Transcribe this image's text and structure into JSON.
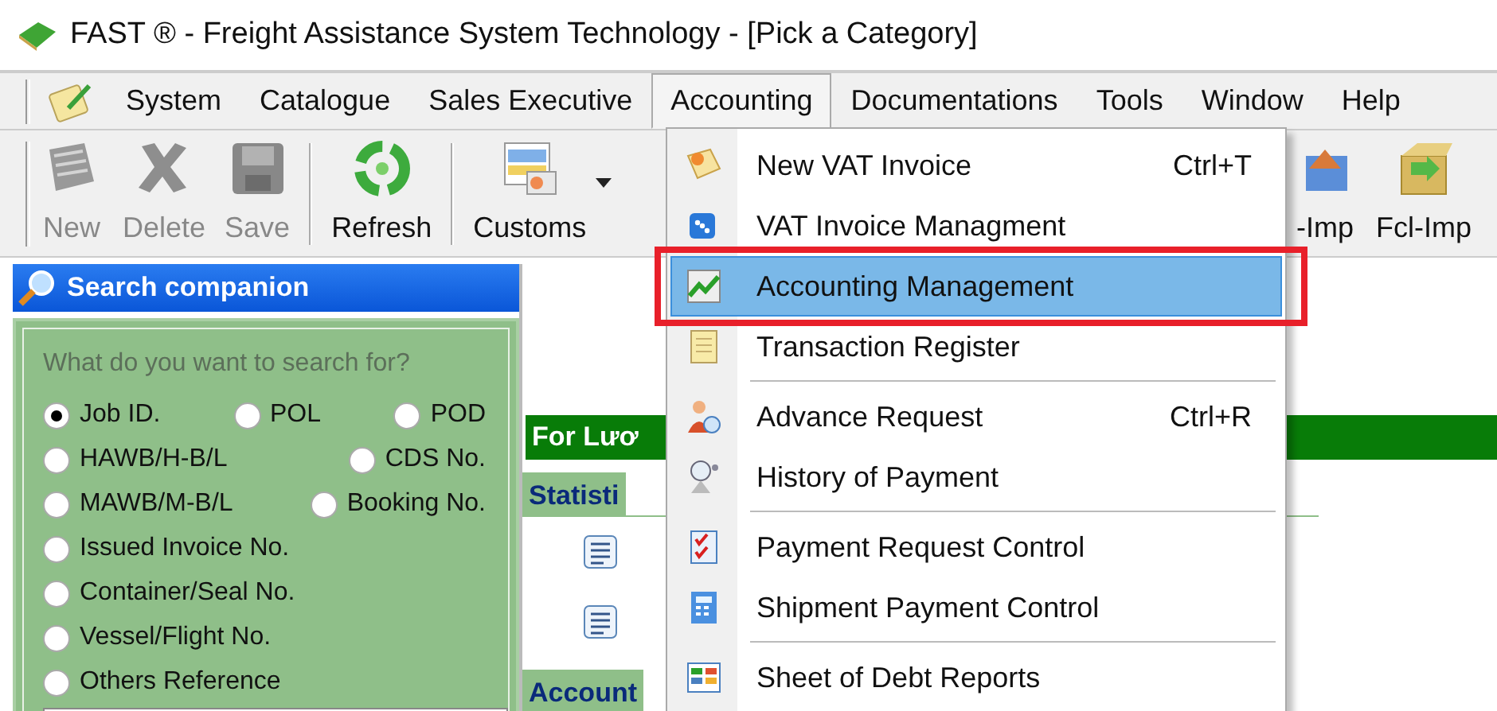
{
  "window": {
    "title": "FAST ® - Freight Assistance System Technology - [Pick a Category]"
  },
  "menubar": [
    {
      "label": "System",
      "open": false
    },
    {
      "label": "Catalogue",
      "open": false
    },
    {
      "label": "Sales Executive",
      "open": false
    },
    {
      "label": "Accounting",
      "open": true
    },
    {
      "label": "Documentations",
      "open": false
    },
    {
      "label": "Tools",
      "open": false
    },
    {
      "label": "Window",
      "open": false
    },
    {
      "label": "Help",
      "open": false
    }
  ],
  "toolbar": [
    {
      "label": "New",
      "disabled": true
    },
    {
      "label": "Delete",
      "disabled": true
    },
    {
      "label": "Save",
      "disabled": true
    },
    {
      "label": "Refresh",
      "disabled": false
    },
    {
      "label": "Customs",
      "disabled": false,
      "dropdown": true
    },
    {
      "label": "-Imp",
      "disabled": false
    },
    {
      "label": "Fcl-Imp",
      "disabled": false
    }
  ],
  "search_panel": {
    "title": "Search companion",
    "question": "What do you want to search for?",
    "options": [
      [
        {
          "label": "Job ID.",
          "selected": true
        },
        {
          "label": "POL",
          "selected": false
        },
        {
          "label": "POD",
          "selected": false
        }
      ],
      [
        {
          "label": "HAWB/H-B/L",
          "selected": false
        },
        {
          "label": "CDS No.",
          "selected": false
        }
      ],
      [
        {
          "label": "MAWB/M-B/L",
          "selected": false
        },
        {
          "label": "Booking No.",
          "selected": false
        }
      ],
      [
        {
          "label": "Issued Invoice No.",
          "selected": false
        }
      ],
      [
        {
          "label": "Container/Seal No.",
          "selected": false
        }
      ],
      [
        {
          "label": "Vessel/Flight No.",
          "selected": false
        }
      ],
      [
        {
          "label": "Others Reference",
          "selected": false
        }
      ]
    ]
  },
  "main": {
    "banner": "For Lươ",
    "sections": [
      {
        "title": "Statisti",
        "entries": [
          {
            "kind": "list"
          },
          {
            "kind": "list"
          }
        ]
      },
      {
        "title": "Account"
      }
    ]
  },
  "menu": [
    {
      "kind": "item",
      "label": "New VAT Invoice",
      "shortcut": "Ctrl+T",
      "selected": false,
      "annotated": false
    },
    {
      "kind": "item",
      "label": "VAT Invoice Managment",
      "selected": false,
      "annotated": false
    },
    {
      "kind": "item",
      "label": "Accounting Management",
      "selected": true,
      "annotated": true
    },
    {
      "kind": "item",
      "label": "Transaction Register",
      "selected": false,
      "annotated": false
    },
    {
      "kind": "separator"
    },
    {
      "kind": "item",
      "label": "Advance Request",
      "shortcut": "Ctrl+R",
      "selected": false,
      "annotated": false
    },
    {
      "kind": "item",
      "label": "History of Payment",
      "selected": false,
      "annotated": false
    },
    {
      "kind": "separator"
    },
    {
      "kind": "item",
      "label": "Payment Request Control",
      "selected": false,
      "annotated": false
    },
    {
      "kind": "item",
      "label": "Shipment Payment Control",
      "selected": false,
      "annotated": false
    },
    {
      "kind": "separator"
    },
    {
      "kind": "item",
      "label": "Sheet of Debt Reports",
      "selected": false,
      "annotated": false
    }
  ]
}
